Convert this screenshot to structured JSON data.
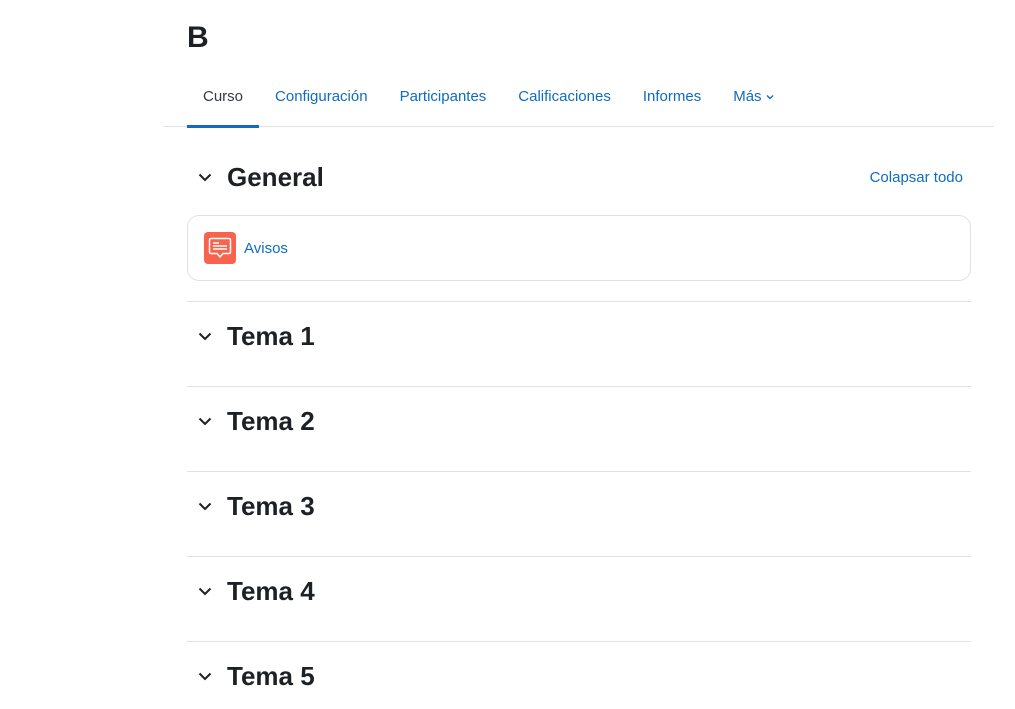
{
  "course": {
    "title": "B"
  },
  "nav": {
    "tabs": [
      {
        "label": "Curso",
        "active": true
      },
      {
        "label": "Configuración"
      },
      {
        "label": "Participantes"
      },
      {
        "label": "Calificaciones"
      },
      {
        "label": "Informes"
      },
      {
        "label": "Más"
      }
    ]
  },
  "general": {
    "title": "General",
    "collapse_all": "Colapsar todo",
    "activities": [
      {
        "name": "Avisos",
        "icon": "forum-icon"
      }
    ]
  },
  "sections": [
    {
      "title": "Tema 1"
    },
    {
      "title": "Tema 2"
    },
    {
      "title": "Tema 3"
    },
    {
      "title": "Tema 4"
    },
    {
      "title": "Tema 5"
    }
  ],
  "colors": {
    "link": "#0f6cbf",
    "text": "#1d2125",
    "border": "#dee2e6",
    "forum_icon_bg": "#f7634d"
  }
}
